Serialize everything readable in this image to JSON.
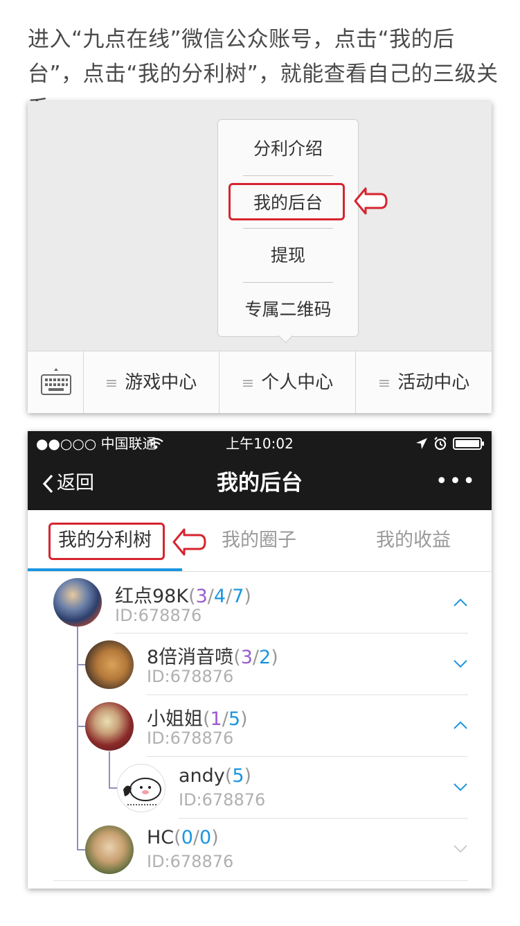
{
  "intro_text": "进入“九点在线”微信公众账号，点击“我的后台”，点击“我的分利树”，就能查看自己的三级关系。",
  "menu_popup": {
    "items": [
      "分利介绍",
      "我的后台",
      "提现",
      "专属二维码"
    ]
  },
  "menu_bar": {
    "items": [
      "游戏中心",
      "个人中心",
      "活动中心"
    ]
  },
  "status_bar": {
    "carrier": "●●○○○ 中国联通",
    "time": "上午10:02"
  },
  "nav": {
    "back_label": "返回",
    "title": "我的后台",
    "more": "•••"
  },
  "tabs": [
    "我的分利树",
    "我的圈子",
    "我的收益"
  ],
  "tree": [
    {
      "name": "红点98K",
      "counts": [
        "3",
        "4",
        "7"
      ],
      "id": "ID:678876",
      "chevron": "^"
    },
    {
      "name": "8倍消音喷",
      "counts": [
        "3",
        "2"
      ],
      "id": "ID:678876",
      "chevron": "v"
    },
    {
      "name": "小姐姐",
      "counts": [
        "1",
        "5"
      ],
      "id": "ID:678876",
      "chevron": "^"
    },
    {
      "name": "andy",
      "counts": [
        "5"
      ],
      "id": "ID:678876",
      "chevron": "v"
    },
    {
      "name": "HC",
      "counts": [
        "0",
        "0"
      ],
      "id": "ID:678876",
      "chevron": "v"
    }
  ],
  "colors": {
    "accent_blue": "#1b95e0",
    "highlight_red": "#d6242f",
    "count_purple": "#9a5bcf",
    "nav_bg": "#1a1a1a"
  }
}
